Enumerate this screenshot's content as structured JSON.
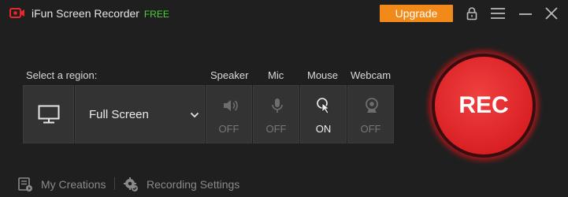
{
  "app": {
    "title": "iFun Screen Recorder",
    "edition": "FREE",
    "upgrade_label": "Upgrade"
  },
  "titlebar_icons": [
    "lock-icon",
    "menu-icon",
    "minimize-icon",
    "close-icon"
  ],
  "region": {
    "label": "Select a region:",
    "selected": "Full Screen",
    "icon": "monitor-icon"
  },
  "toggles": [
    {
      "id": "speaker",
      "label": "Speaker",
      "state": "OFF",
      "icon": "speaker-icon"
    },
    {
      "id": "mic",
      "label": "Mic",
      "state": "OFF",
      "icon": "mic-icon"
    },
    {
      "id": "mouse",
      "label": "Mouse",
      "state": "ON",
      "icon": "mouse-click-icon"
    },
    {
      "id": "webcam",
      "label": "Webcam",
      "state": "OFF",
      "icon": "webcam-icon"
    }
  ],
  "rec": {
    "label": "REC"
  },
  "footer": {
    "creations": "My Creations",
    "settings": "Recording Settings"
  },
  "colors": {
    "accent": "#f28a1a",
    "rec_red": "#e8262c",
    "free_green": "#4cd137",
    "background": "#1f1f1f"
  }
}
